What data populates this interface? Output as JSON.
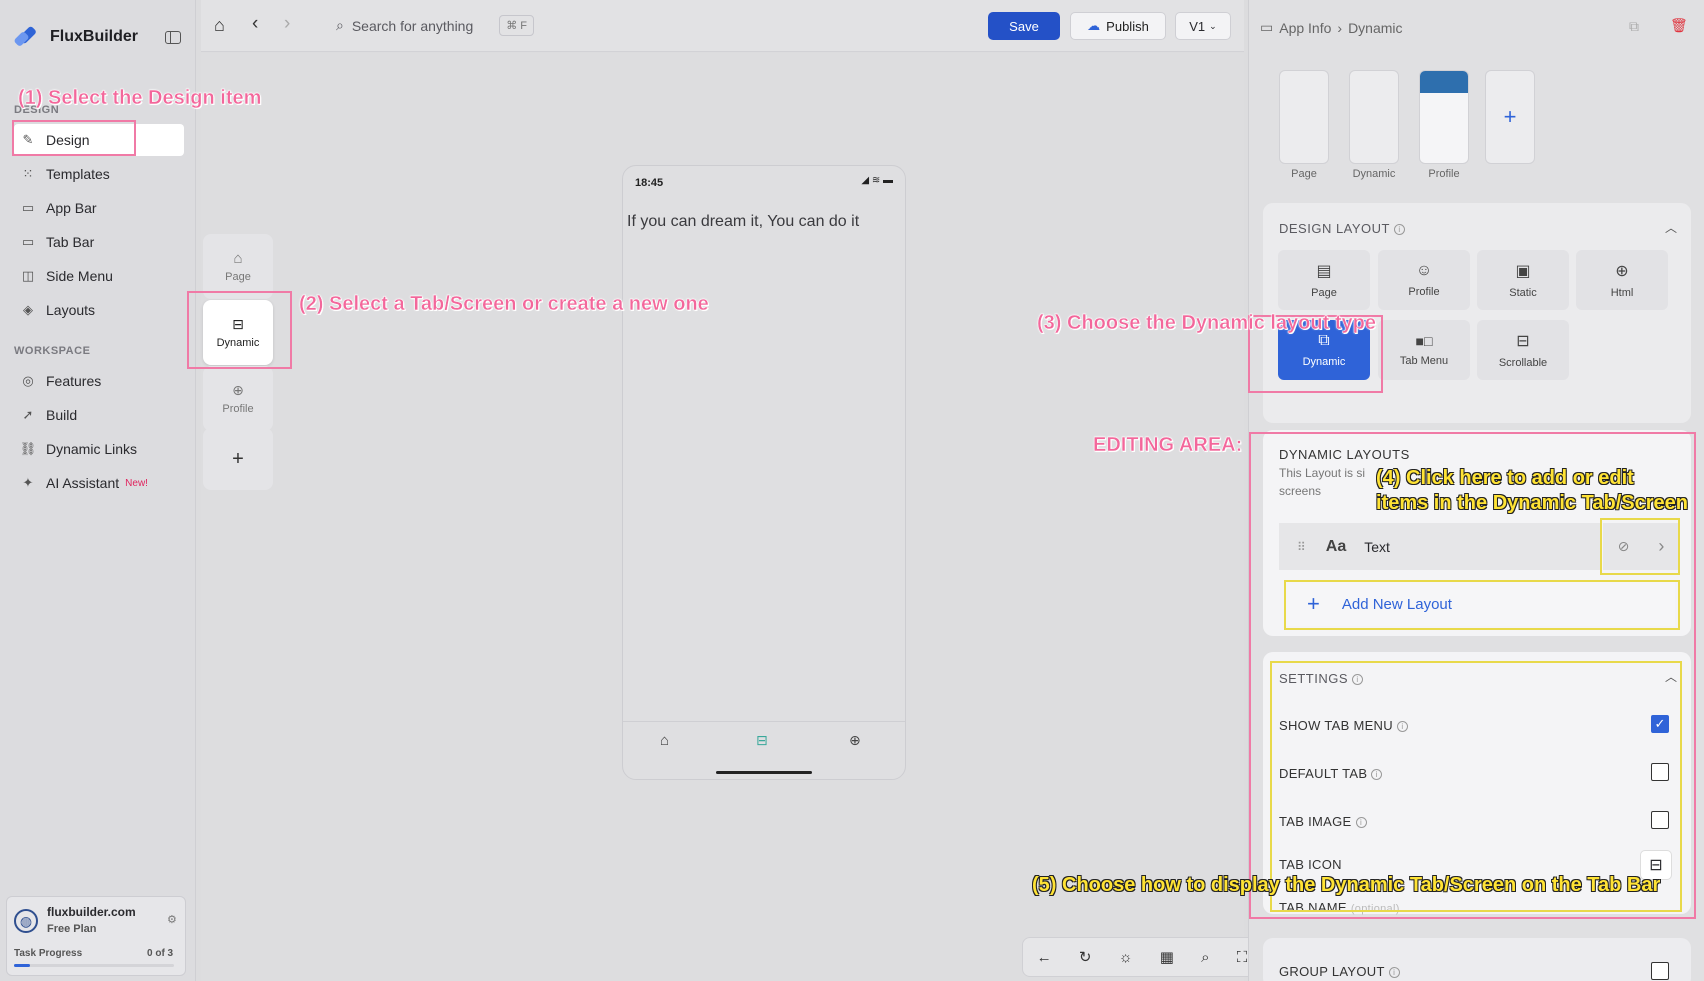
{
  "app": {
    "name": "FluxBuilder"
  },
  "sidebar": {
    "design_section": "DESIGN",
    "design_items": [
      {
        "label": "Design",
        "icon": "brush-icon"
      },
      {
        "label": "Templates",
        "icon": "grid-icon"
      },
      {
        "label": "App Bar",
        "icon": "appbar-icon"
      },
      {
        "label": "Tab Bar",
        "icon": "tabbar-icon"
      },
      {
        "label": "Side Menu",
        "icon": "sidemenu-icon"
      },
      {
        "label": "Layouts",
        "icon": "layers-icon"
      }
    ],
    "workspace_section": "WORKSPACE",
    "workspace_items": [
      {
        "label": "Features",
        "icon": "features-icon"
      },
      {
        "label": "Build",
        "icon": "rocket-icon"
      },
      {
        "label": "Dynamic Links",
        "icon": "link-icon"
      },
      {
        "label": "AI Assistant",
        "icon": "sparkle-icon",
        "badge": "New!"
      }
    ],
    "plan": {
      "site": "fluxbuilder.com",
      "plan": "Free Plan",
      "task_label": "Task Progress",
      "task_count": "0 of 3",
      "progress": 0.1
    }
  },
  "topbar": {
    "search_placeholder": "Search for anything",
    "shortcut": "⌘ F",
    "save": "Save",
    "publish": "Publish",
    "version": "V1"
  },
  "tabs": [
    {
      "label": "Page"
    },
    {
      "label": "Dynamic"
    },
    {
      "label": "Profile"
    }
  ],
  "phone": {
    "time": "18:45",
    "text": "If you can dream it, You can do it"
  },
  "panel": {
    "breadcrumb": [
      "App Info",
      "Dynamic"
    ],
    "thumbs": [
      "Page",
      "Dynamic",
      "Profile"
    ],
    "design_layout_title": "DESIGN LAYOUT",
    "layouts": [
      "Page",
      "Profile",
      "Static",
      "Html",
      "Dynamic",
      "Tab Menu",
      "Scrollable"
    ],
    "dynamic_title": "DYNAMIC LAYOUTS",
    "dynamic_desc_1": "This Layout is si",
    "dynamic_desc_1b": "i-",
    "dynamic_desc_2": "screens",
    "layout_item": "Text",
    "add_layout": "Add New Layout",
    "settings_title": "SETTINGS",
    "settings": [
      {
        "label": "SHOW TAB MENU",
        "checked": true
      },
      {
        "label": "DEFAULT TAB",
        "checked": false
      },
      {
        "label": "TAB IMAGE",
        "checked": false
      }
    ],
    "tab_icon": "TAB ICON",
    "tab_name": "TAB NAME",
    "tab_name_hint": "(optional)",
    "group_layout": "GROUP LAYOUT"
  },
  "annotations": {
    "a1": "(1) Select the Design item",
    "a2": "(2) Select a Tab/Screen or create a new one",
    "a3": "(3) Choose the Dynamic layout type",
    "editing": "EDITING AREA:",
    "a4_line1": "(4) Click here to add or edit",
    "a4_line2": "items in the Dynamic Tab/Screen",
    "a5": "(5) Choose how to display the Dynamic Tab/Screen on the Tab Bar"
  },
  "colors": {
    "accent": "#2f63d8",
    "annotation_pink": "#f3679b",
    "annotation_yellow": "#ffe335"
  }
}
